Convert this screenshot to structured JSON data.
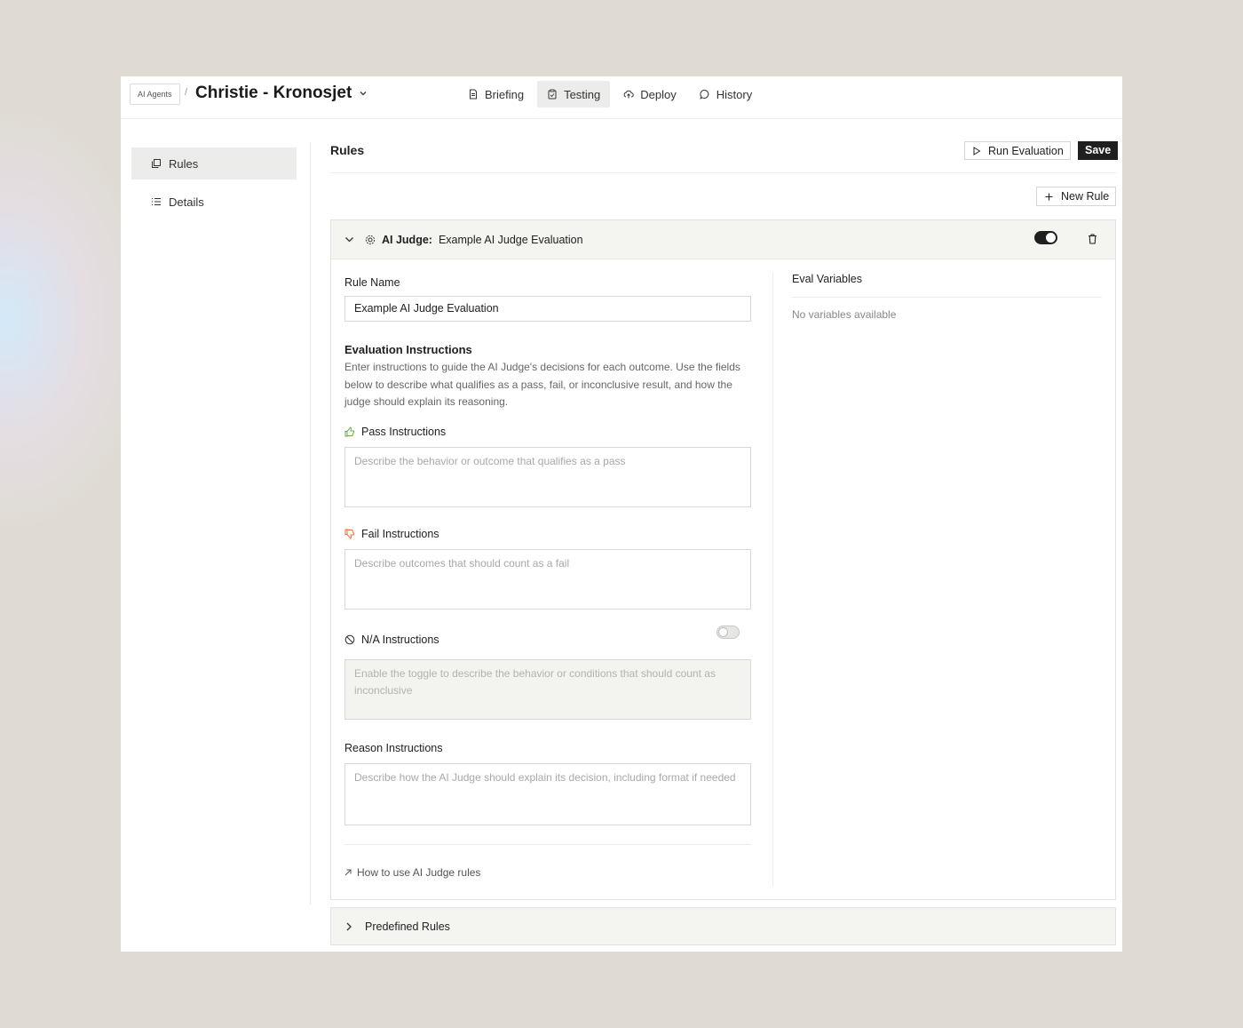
{
  "header": {
    "breadcrumb_parent": "AI Agents",
    "breadcrumb_separator": "/",
    "title": "Christie - Kronosjet",
    "tabs": [
      {
        "label": "Briefing",
        "icon": "document-icon"
      },
      {
        "label": "Testing",
        "icon": "clipboard-icon",
        "active": true
      },
      {
        "label": "Deploy",
        "icon": "cloud-upload-icon"
      },
      {
        "label": "History",
        "icon": "chat-history-icon"
      }
    ]
  },
  "sidebar": {
    "items": [
      {
        "label": "Rules",
        "icon": "copy-stack-icon",
        "active": true
      },
      {
        "label": "Details",
        "icon": "list-icon"
      }
    ]
  },
  "main": {
    "title": "Rules",
    "run_label": "Run Evaluation",
    "save_label": "Save",
    "new_rule_label": "New Rule"
  },
  "rule": {
    "type_label": "AI Judge:",
    "header_name": "Example AI Judge Evaluation",
    "enabled": true,
    "name_label": "Rule Name",
    "name_value": "Example AI Judge Evaluation",
    "eval_title": "Evaluation Instructions",
    "eval_desc": "Enter instructions to guide the AI Judge's decisions for each outcome. Use the fields below to describe what qualifies as a pass, fail, or inconclusive result, and how the judge should explain its reasoning.",
    "pass_label": "Pass Instructions",
    "pass_placeholder": "Describe the behavior or outcome that qualifies as a pass",
    "fail_label": "Fail Instructions",
    "fail_placeholder": "Describe outcomes that should count as a fail",
    "na_label": "N/A Instructions",
    "na_enabled": false,
    "na_placeholder": "Enable the toggle to describe the behavior or conditions that should count as inconclusive",
    "reason_label": "Reason Instructions",
    "reason_placeholder": "Describe how the AI Judge should explain its decision, including format if needed",
    "help_link": "How to use AI Judge rules",
    "variables_title": "Eval Variables",
    "variables_empty": "No variables available"
  },
  "predefined": {
    "label": "Predefined Rules"
  },
  "colors": {
    "background": "#dfdbd3",
    "accent": "#1f1f1f",
    "pass_icon": "#6aa84f",
    "fail_icon": "#e07040"
  }
}
